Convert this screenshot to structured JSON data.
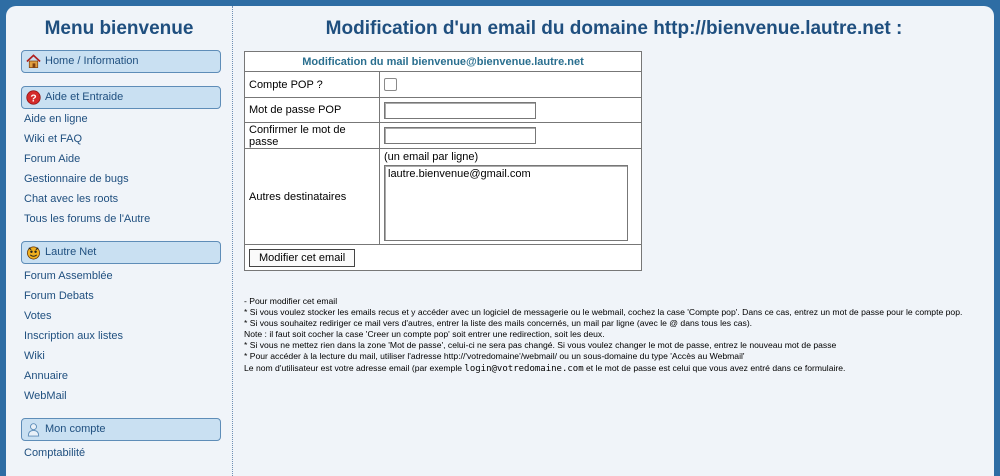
{
  "sidebar": {
    "title": "Menu bienvenue",
    "sections": [
      {
        "icon": "home-icon",
        "label": "Home / Information",
        "items": []
      },
      {
        "icon": "help-icon",
        "label": "Aide et Entraide",
        "items": [
          "Aide en ligne",
          "Wiki et FAQ",
          "Forum Aide",
          "Gestionnaire de bugs",
          "Chat avec les roots",
          "Tous les forums de l'Autre"
        ]
      },
      {
        "icon": "lautre-logo-icon",
        "label": "Lautre Net",
        "items": [
          "Forum Assemblée",
          "Forum Debats",
          "Votes",
          "Inscription aux listes",
          "Wiki",
          "Annuaire",
          "WebMail"
        ]
      },
      {
        "icon": "user-icon",
        "label": "Mon compte",
        "items": [
          "Comptabilité"
        ]
      }
    ]
  },
  "main": {
    "title": "Modification d'un email du domaine http://bienvenue.lautre.net :",
    "form": {
      "caption": "Modification du mail bienvenue@bienvenue.lautre.net",
      "pop_label": "Compte POP ?",
      "pop_checked": false,
      "password_label": "Mot de passe POP",
      "confirm_label": "Confirmer le mot de passe",
      "recipients_label": "Autres destinataires",
      "recipients_hint": "(un email par ligne)",
      "recipients_value": "lautre.bienvenue@gmail.com",
      "submit_label": "Modifier cet email"
    },
    "help": {
      "line1": "- Pour modifier cet email",
      "line2": "* Si vous voulez stocker les emails recus et y accéder avec un logiciel de messagerie ou le webmail, cochez la case 'Compte pop'. Dans ce cas, entrez un mot de passe pour le compte pop.",
      "line3": "* Si vous souhaitez rediriger ce mail vers d'autres, entrer la liste des mails concernés, un mail par ligne (avec le @ dans tous les cas).",
      "line4": "Note : il faut soit cocher la case 'Creer un compte pop' soit entrer une redirection, soit les deux.",
      "line5": "* Si vous ne mettez rien dans la zone 'Mot de passe', celui-ci ne sera pas changé. Si vous voulez changer le mot de passe, entrez le nouveau mot de passe",
      "line6": "* Pour accéder à la lecture du mail, utiliser l'adresse http://'votredomaine'/webmail/ ou un sous-domaine du type 'Accès au Webmail'",
      "line7_pre": "Le nom d'utilisateur est votre adresse email (par exemple ",
      "line7_code": "login@votredomaine.com",
      "line7_post": " et le mot de passe est celui que vous avez entré dans ce formulaire."
    }
  }
}
